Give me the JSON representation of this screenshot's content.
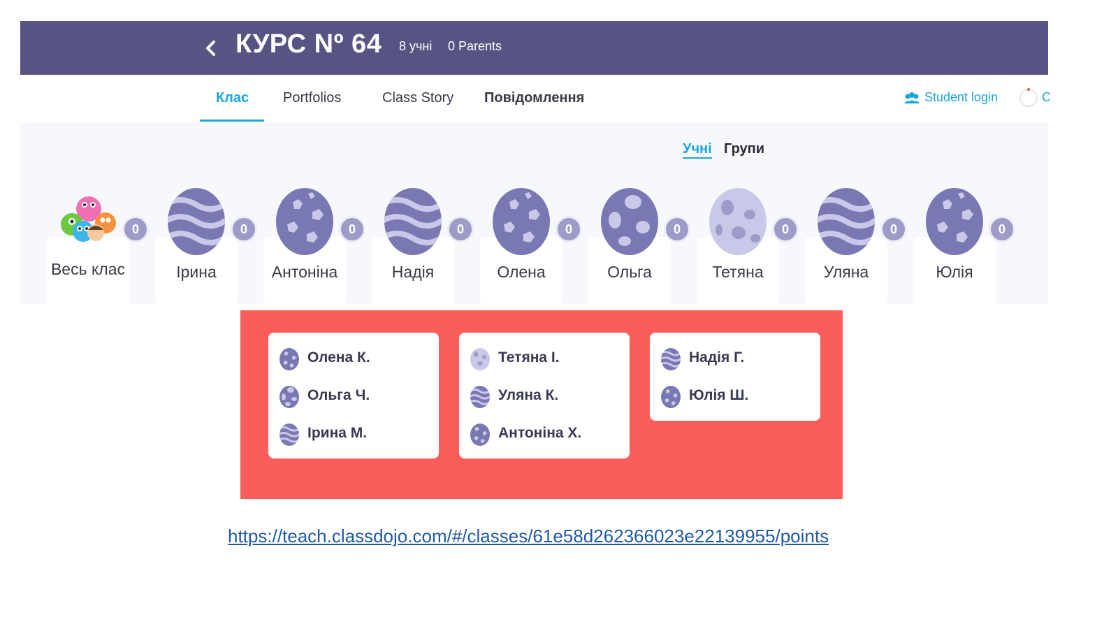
{
  "header": {
    "title": "КУРС Nº 64",
    "students_count": "8 учні",
    "parents_count": "0 Parents"
  },
  "nav": {
    "tabs": [
      {
        "label": "Клас",
        "active": true
      },
      {
        "label": "Portfolios"
      },
      {
        "label": "Class Story"
      },
      {
        "label": "Повідомлення"
      }
    ],
    "student_login": "Student login",
    "overflow_text": "С"
  },
  "view_toggle": {
    "students_label": "Учні",
    "groups_label": "Групи",
    "active": "students"
  },
  "students": [
    {
      "name": "Весь клас",
      "points": "0",
      "avatar": "monsters-icon"
    },
    {
      "name": "Ірина",
      "points": "0",
      "avatar": "egg-waves-icon"
    },
    {
      "name": "Антоніна",
      "points": "0",
      "avatar": "egg-hex-icon"
    },
    {
      "name": "Надія",
      "points": "0",
      "avatar": "egg-waves-icon"
    },
    {
      "name": "Олена",
      "points": "0",
      "avatar": "egg-hex-icon"
    },
    {
      "name": "Ольга",
      "points": "0",
      "avatar": "egg-spots-icon"
    },
    {
      "name": "Тетяна",
      "points": "0",
      "avatar": "egg-light-spots-icon"
    },
    {
      "name": "Уляна",
      "points": "0",
      "avatar": "egg-waves-icon"
    },
    {
      "name": "Юлія",
      "points": "0",
      "avatar": "egg-hex-icon"
    }
  ],
  "groups": [
    {
      "members": [
        {
          "name": "Олена К.",
          "avatar": "egg-hex-icon"
        },
        {
          "name": "Ольга Ч.",
          "avatar": "egg-spots-icon"
        },
        {
          "name": "Ірина М.",
          "avatar": "egg-waves-icon"
        }
      ]
    },
    {
      "members": [
        {
          "name": "Тетяна І.",
          "avatar": "egg-light-spots-icon"
        },
        {
          "name": "Уляна К.",
          "avatar": "egg-waves-icon"
        },
        {
          "name": "Антоніна Х.",
          "avatar": "egg-hex-icon"
        }
      ]
    },
    {
      "members": [
        {
          "name": "Надія Г.",
          "avatar": "egg-waves-icon"
        },
        {
          "name": "Юлія Ш.",
          "avatar": "egg-hex-icon"
        }
      ]
    }
  ],
  "link": {
    "text": "https://teach.classdojo.com/#/classes/61e58d262366023e22139955/points"
  },
  "colors": {
    "header_bg": "#575483",
    "accent": "#1aa6d9",
    "groups_bg": "#fb5e5a",
    "egg_dark": "#7a78b3",
    "egg_light": "#c9c8e8"
  }
}
